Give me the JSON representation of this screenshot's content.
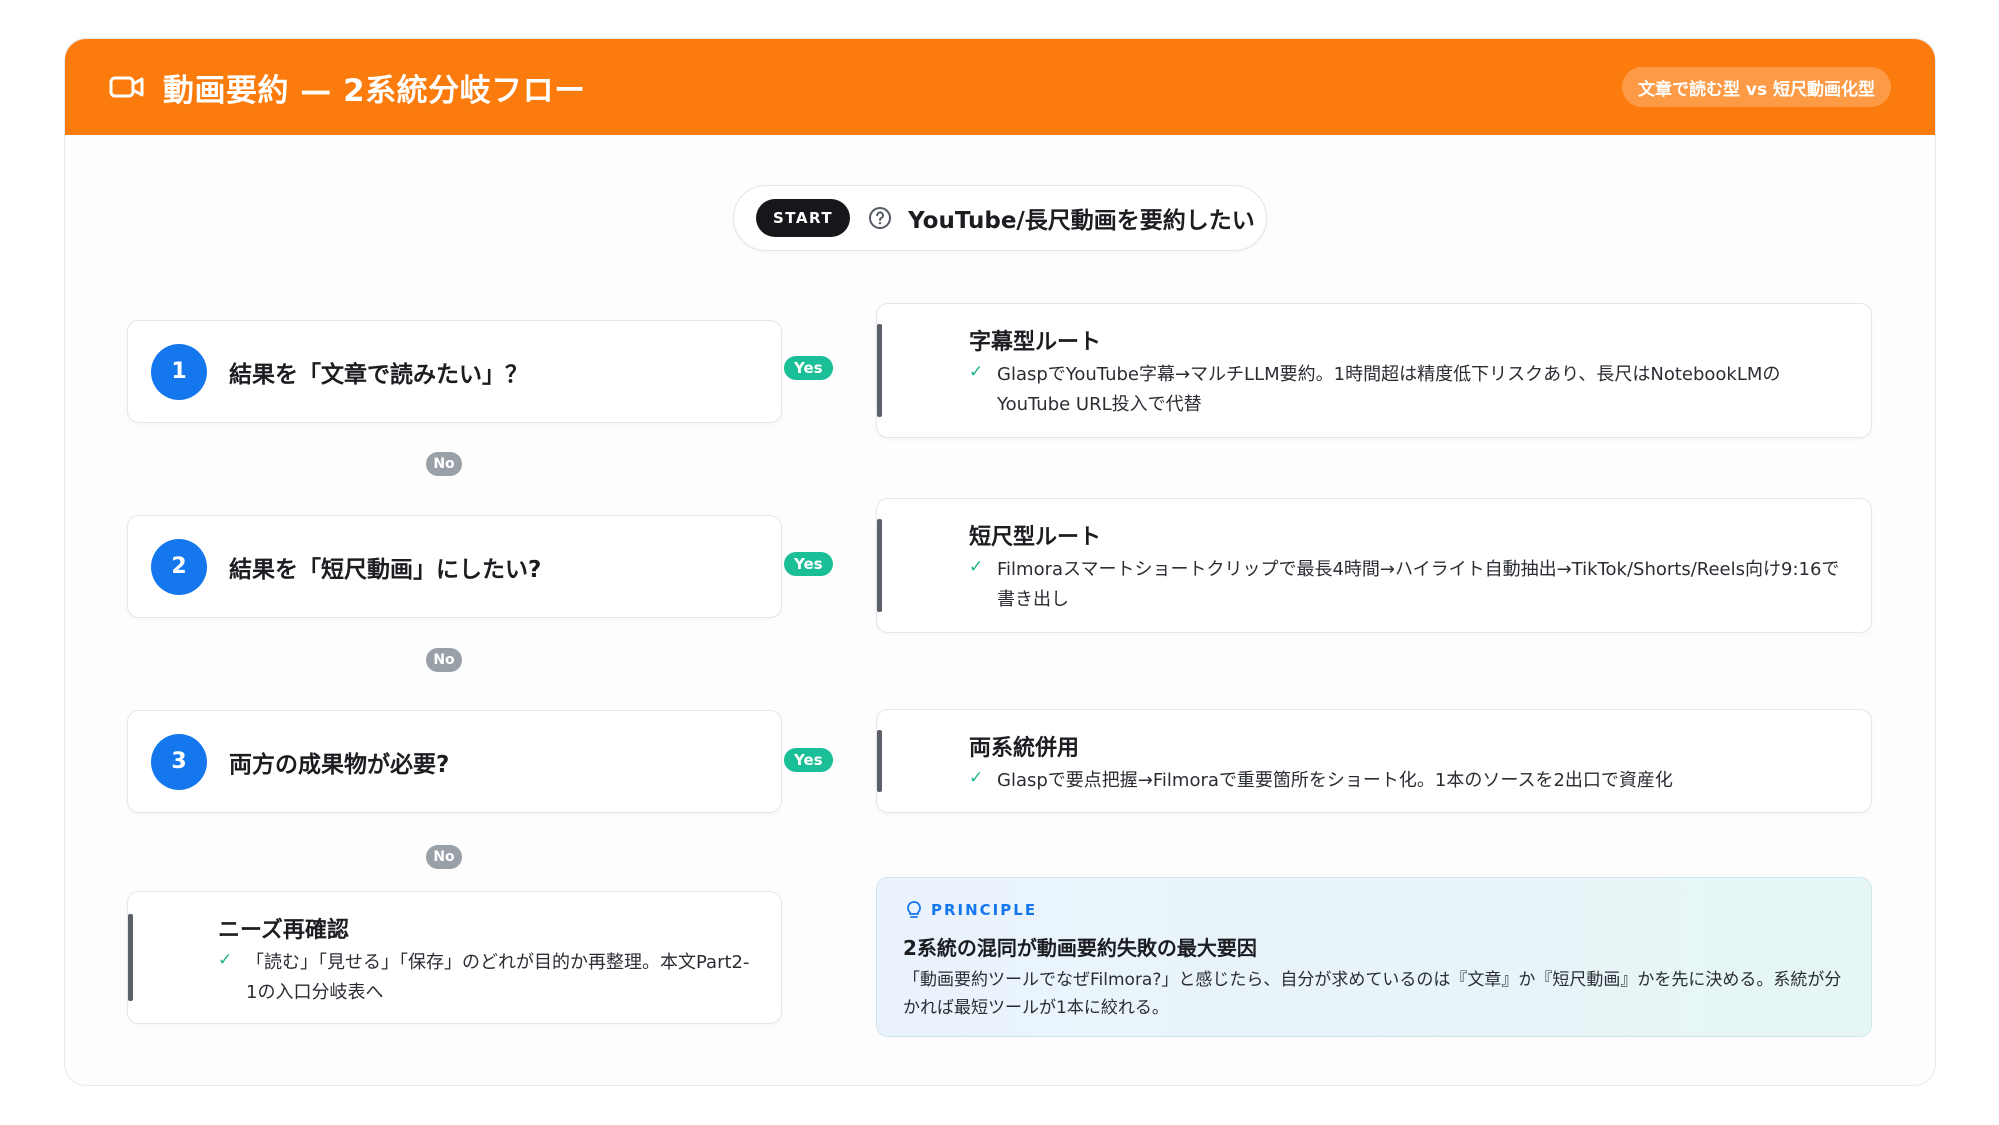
{
  "header": {
    "icon": "video-camera-icon",
    "title": "動画要約 — 2系統分岐フロー",
    "tag": "文章で読む型 vs 短尺動画化型"
  },
  "start": {
    "badge": "START",
    "icon": "question-circle-icon",
    "text": "YouTube/長尺動画を要約したい"
  },
  "questions": [
    {
      "num": "1",
      "text": "結果を「文章で読みたい」？"
    },
    {
      "num": "2",
      "text": "結果を「短尺動画」にしたい?"
    },
    {
      "num": "3",
      "text": "両方の成果物が必要?"
    }
  ],
  "branch_labels": {
    "yes": "Yes",
    "no": "No"
  },
  "routes": [
    {
      "title": "字幕型ルート",
      "desc": "GlaspでYouTube字幕→マルチLLM要約。1時間超は精度低下リスクあり、長尺はNotebookLMのYouTube URL投入で代替"
    },
    {
      "title": "短尺型ルート",
      "desc": "Filmoraスマートショートクリップで最長4時間→ハイライト自動抽出→TikTok/Shorts/Reels向け9:16で書き出し"
    },
    {
      "title": "両系統併用",
      "desc": "Glaspで要点把握→Filmoraで重要箇所をショート化。1本のソースを2出口で資産化"
    }
  ],
  "fallback": {
    "title": "ニーズ再確認",
    "desc": "「読む」「見せる」「保存」のどれが目的か再整理。本文Part2-1の入口分岐表へ"
  },
  "principle": {
    "label": "PRINCIPLE",
    "icon": "lightbulb-icon",
    "title": "2系統の混同が動画要約失敗の最大要因",
    "desc": "「動画要約ツールでなぜFilmora?」と感じたら、自分が求めているのは『文章』か『短尺動画』かを先に決める。系統が分かれば最短ツールが1本に絞れる。"
  },
  "colors": {
    "header": "#fb7b0c",
    "number_badge": "#1477ee",
    "yes": "#1bbf97",
    "no": "#9aa0a8",
    "check": "#20b28f"
  }
}
